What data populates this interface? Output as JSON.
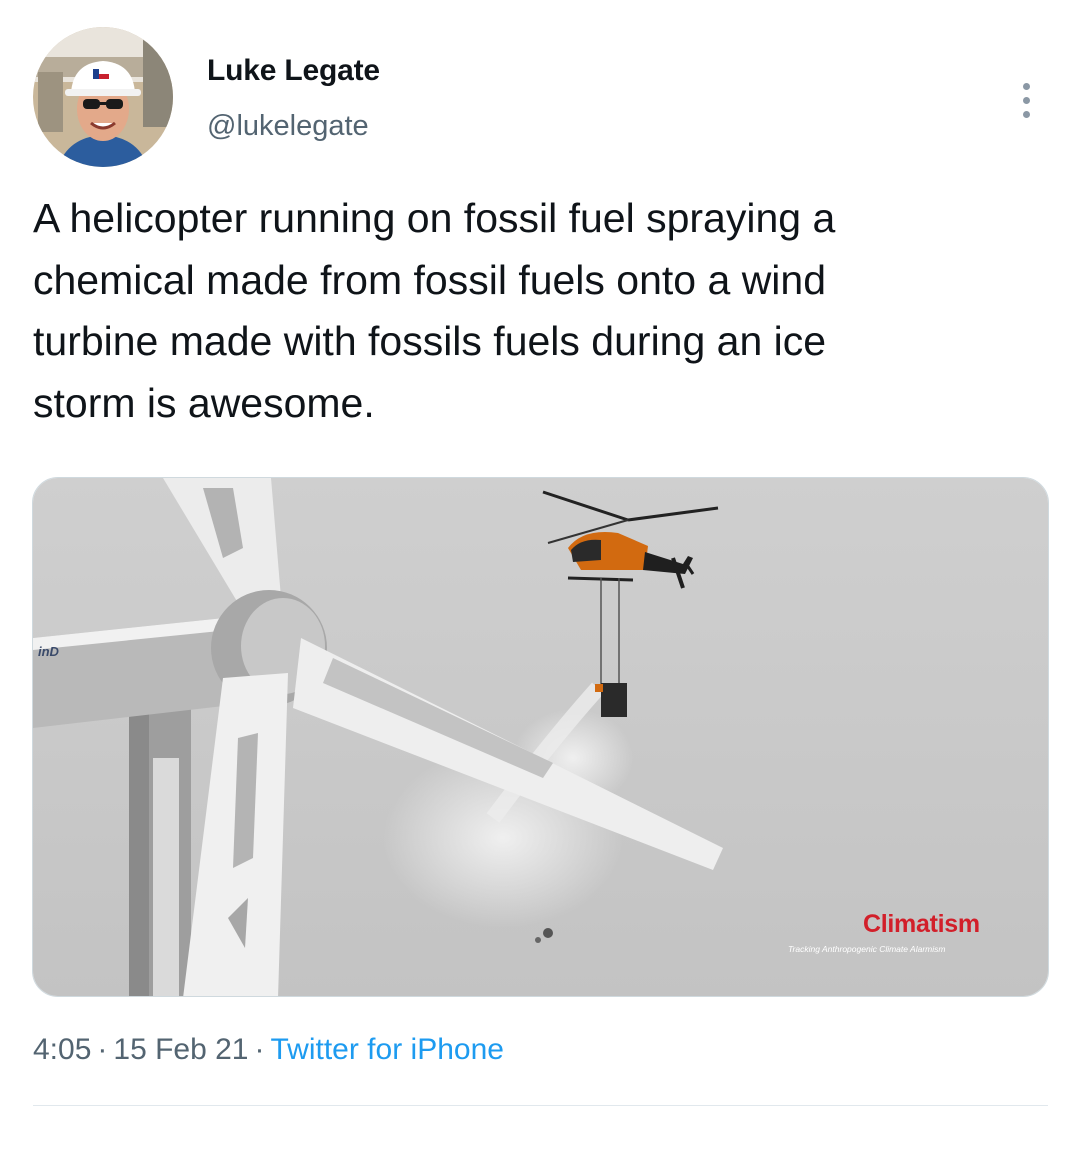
{
  "author": {
    "display_name": "Luke Legate",
    "handle": "@lukelegate",
    "avatar_icon": "profile-photo-hardhat"
  },
  "tweet": {
    "text": "A helicopter running on fossil fuel spraying a\nchemical made from fossil fuels onto a wind\nturbine made with fossils fuels during an ice\nstorm is awesome."
  },
  "media": {
    "watermark_title": "Climatism",
    "watermark_subtitle": "Tracking Anthropogenic Climate Alarmism",
    "nacelle_logo": "inD"
  },
  "meta": {
    "time": "4:05",
    "separator": "·",
    "date": "15 Feb 21",
    "source": "Twitter for iPhone"
  },
  "colors": {
    "accent": "#1d9bf0",
    "secondary_text": "#536471",
    "primary_text": "#0f1419",
    "watermark_red": "#d21f2a"
  },
  "icons": {
    "more": "more-vertical-icon"
  }
}
